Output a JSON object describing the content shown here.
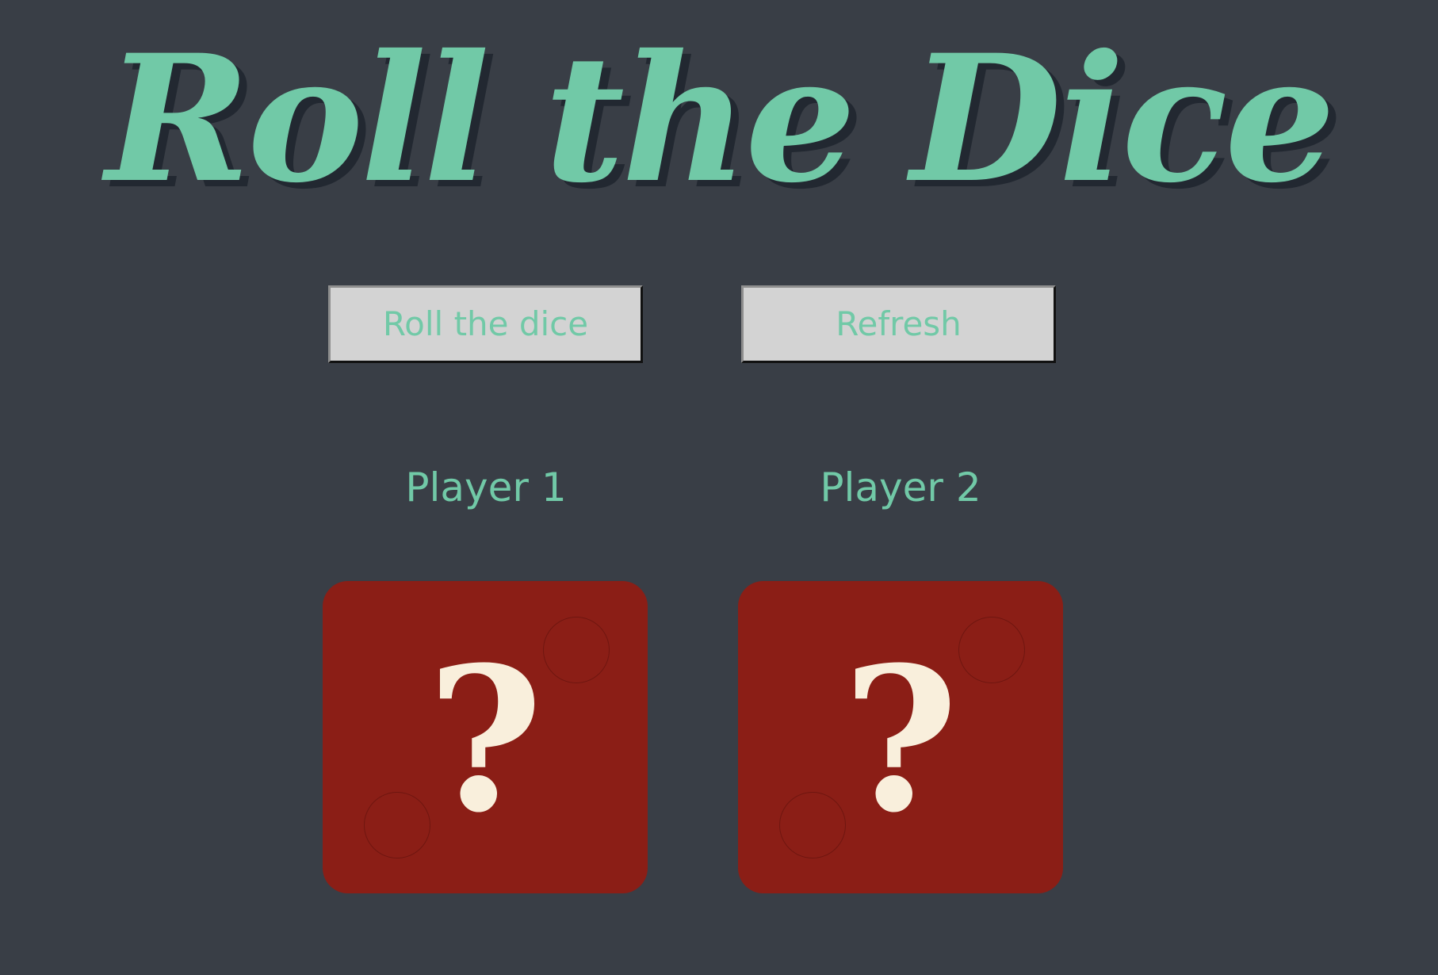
{
  "title": "Roll the Dice",
  "buttons": {
    "roll_label": "Roll the dice",
    "refresh_label": "Refresh"
  },
  "players": [
    {
      "label": "Player 1",
      "die_face": "?"
    },
    {
      "label": "Player 2",
      "die_face": "?"
    }
  ],
  "colors": {
    "background": "#393e46",
    "accent": "#71c9a7",
    "title_shadow": "#222831",
    "button_bg": "#d3d3d3",
    "die": "#8b1e16",
    "die_glyph": "#f9efdc"
  }
}
